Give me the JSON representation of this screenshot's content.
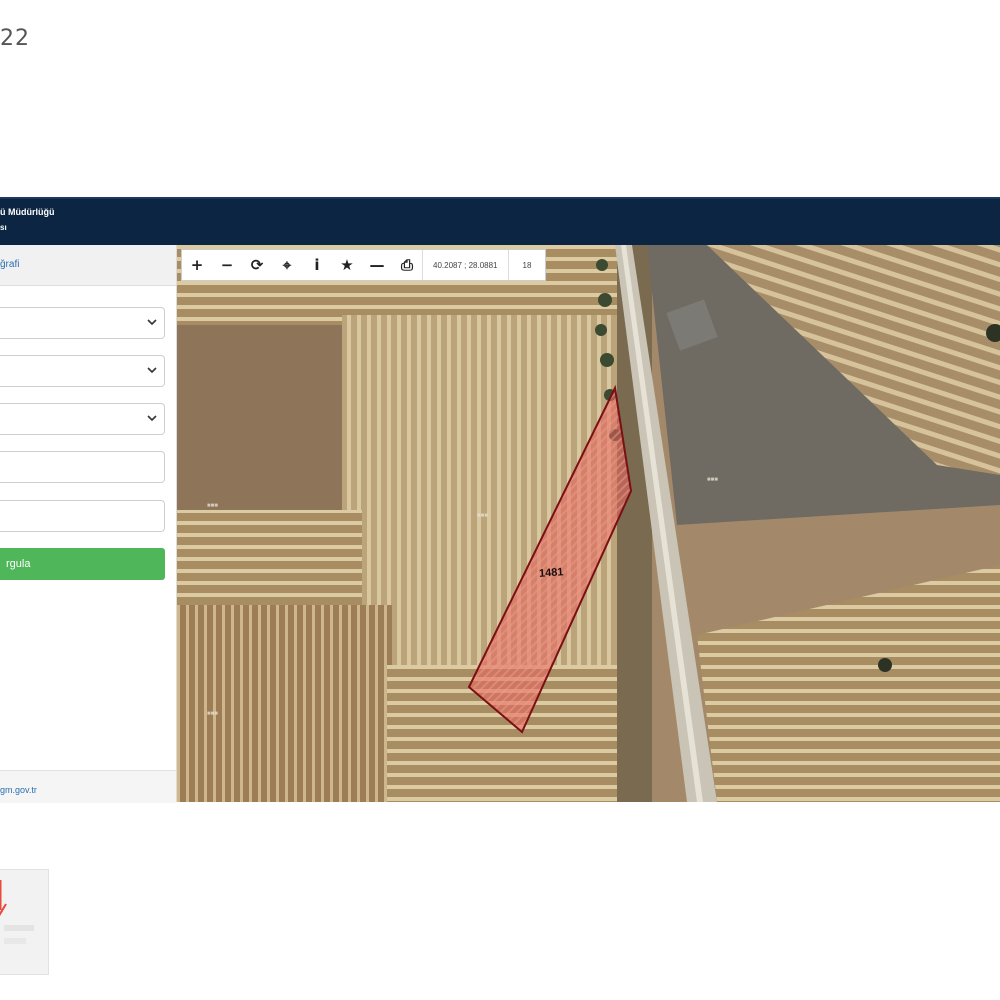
{
  "page": {
    "number_fragment": "22"
  },
  "header": {
    "title_fragment": "ü Müdürlüğü",
    "subtitle_fragment": "sı"
  },
  "sidebar": {
    "tab_label_fragment": "ğrafi",
    "query_button_label_fragment": "rgula",
    "footer_link_fragment": "gm.gov.tr"
  },
  "toolbar": {
    "buttons": [
      {
        "name": "zoom-in",
        "glyph": "+"
      },
      {
        "name": "zoom-out",
        "glyph": "−"
      },
      {
        "name": "refresh",
        "glyph": "⟳"
      },
      {
        "name": "locate",
        "glyph": "⌖"
      },
      {
        "name": "info",
        "glyph": "i"
      },
      {
        "name": "favorite",
        "glyph": "★"
      },
      {
        "name": "measure",
        "glyph": "—"
      },
      {
        "name": "print",
        "glyph": "⎙"
      }
    ],
    "coordinate_readout": "40.2087 ; 28.0881",
    "zoom_level": "18"
  },
  "map": {
    "parcel_number": "1481",
    "parcel_color": "#e8645a",
    "parcel_outline_color": "#7a0f14"
  }
}
